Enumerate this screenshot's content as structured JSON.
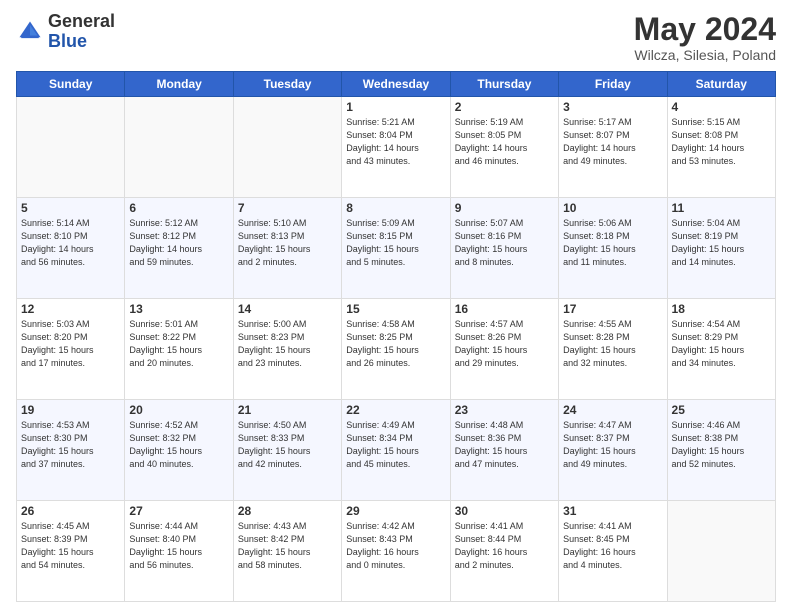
{
  "header": {
    "logo_general": "General",
    "logo_blue": "Blue",
    "title": "May 2024",
    "location": "Wilcza, Silesia, Poland"
  },
  "days_of_week": [
    "Sunday",
    "Monday",
    "Tuesday",
    "Wednesday",
    "Thursday",
    "Friday",
    "Saturday"
  ],
  "weeks": [
    [
      {
        "day": "",
        "info": ""
      },
      {
        "day": "",
        "info": ""
      },
      {
        "day": "",
        "info": ""
      },
      {
        "day": "1",
        "info": "Sunrise: 5:21 AM\nSunset: 8:04 PM\nDaylight: 14 hours\nand 43 minutes."
      },
      {
        "day": "2",
        "info": "Sunrise: 5:19 AM\nSunset: 8:05 PM\nDaylight: 14 hours\nand 46 minutes."
      },
      {
        "day": "3",
        "info": "Sunrise: 5:17 AM\nSunset: 8:07 PM\nDaylight: 14 hours\nand 49 minutes."
      },
      {
        "day": "4",
        "info": "Sunrise: 5:15 AM\nSunset: 8:08 PM\nDaylight: 14 hours\nand 53 minutes."
      }
    ],
    [
      {
        "day": "5",
        "info": "Sunrise: 5:14 AM\nSunset: 8:10 PM\nDaylight: 14 hours\nand 56 minutes."
      },
      {
        "day": "6",
        "info": "Sunrise: 5:12 AM\nSunset: 8:12 PM\nDaylight: 14 hours\nand 59 minutes."
      },
      {
        "day": "7",
        "info": "Sunrise: 5:10 AM\nSunset: 8:13 PM\nDaylight: 15 hours\nand 2 minutes."
      },
      {
        "day": "8",
        "info": "Sunrise: 5:09 AM\nSunset: 8:15 PM\nDaylight: 15 hours\nand 5 minutes."
      },
      {
        "day": "9",
        "info": "Sunrise: 5:07 AM\nSunset: 8:16 PM\nDaylight: 15 hours\nand 8 minutes."
      },
      {
        "day": "10",
        "info": "Sunrise: 5:06 AM\nSunset: 8:18 PM\nDaylight: 15 hours\nand 11 minutes."
      },
      {
        "day": "11",
        "info": "Sunrise: 5:04 AM\nSunset: 8:19 PM\nDaylight: 15 hours\nand 14 minutes."
      }
    ],
    [
      {
        "day": "12",
        "info": "Sunrise: 5:03 AM\nSunset: 8:20 PM\nDaylight: 15 hours\nand 17 minutes."
      },
      {
        "day": "13",
        "info": "Sunrise: 5:01 AM\nSunset: 8:22 PM\nDaylight: 15 hours\nand 20 minutes."
      },
      {
        "day": "14",
        "info": "Sunrise: 5:00 AM\nSunset: 8:23 PM\nDaylight: 15 hours\nand 23 minutes."
      },
      {
        "day": "15",
        "info": "Sunrise: 4:58 AM\nSunset: 8:25 PM\nDaylight: 15 hours\nand 26 minutes."
      },
      {
        "day": "16",
        "info": "Sunrise: 4:57 AM\nSunset: 8:26 PM\nDaylight: 15 hours\nand 29 minutes."
      },
      {
        "day": "17",
        "info": "Sunrise: 4:55 AM\nSunset: 8:28 PM\nDaylight: 15 hours\nand 32 minutes."
      },
      {
        "day": "18",
        "info": "Sunrise: 4:54 AM\nSunset: 8:29 PM\nDaylight: 15 hours\nand 34 minutes."
      }
    ],
    [
      {
        "day": "19",
        "info": "Sunrise: 4:53 AM\nSunset: 8:30 PM\nDaylight: 15 hours\nand 37 minutes."
      },
      {
        "day": "20",
        "info": "Sunrise: 4:52 AM\nSunset: 8:32 PM\nDaylight: 15 hours\nand 40 minutes."
      },
      {
        "day": "21",
        "info": "Sunrise: 4:50 AM\nSunset: 8:33 PM\nDaylight: 15 hours\nand 42 minutes."
      },
      {
        "day": "22",
        "info": "Sunrise: 4:49 AM\nSunset: 8:34 PM\nDaylight: 15 hours\nand 45 minutes."
      },
      {
        "day": "23",
        "info": "Sunrise: 4:48 AM\nSunset: 8:36 PM\nDaylight: 15 hours\nand 47 minutes."
      },
      {
        "day": "24",
        "info": "Sunrise: 4:47 AM\nSunset: 8:37 PM\nDaylight: 15 hours\nand 49 minutes."
      },
      {
        "day": "25",
        "info": "Sunrise: 4:46 AM\nSunset: 8:38 PM\nDaylight: 15 hours\nand 52 minutes."
      }
    ],
    [
      {
        "day": "26",
        "info": "Sunrise: 4:45 AM\nSunset: 8:39 PM\nDaylight: 15 hours\nand 54 minutes."
      },
      {
        "day": "27",
        "info": "Sunrise: 4:44 AM\nSunset: 8:40 PM\nDaylight: 15 hours\nand 56 minutes."
      },
      {
        "day": "28",
        "info": "Sunrise: 4:43 AM\nSunset: 8:42 PM\nDaylight: 15 hours\nand 58 minutes."
      },
      {
        "day": "29",
        "info": "Sunrise: 4:42 AM\nSunset: 8:43 PM\nDaylight: 16 hours\nand 0 minutes."
      },
      {
        "day": "30",
        "info": "Sunrise: 4:41 AM\nSunset: 8:44 PM\nDaylight: 16 hours\nand 2 minutes."
      },
      {
        "day": "31",
        "info": "Sunrise: 4:41 AM\nSunset: 8:45 PM\nDaylight: 16 hours\nand 4 minutes."
      },
      {
        "day": "",
        "info": ""
      }
    ]
  ]
}
